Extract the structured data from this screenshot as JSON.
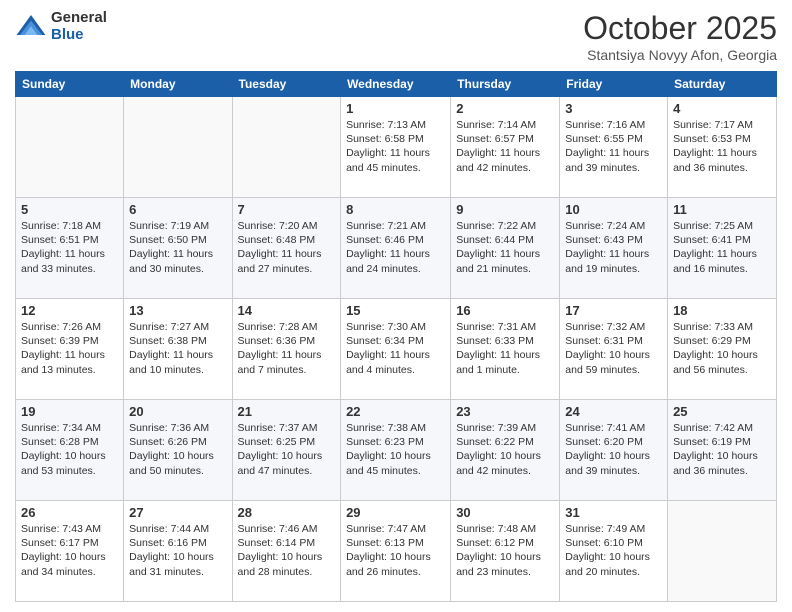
{
  "logo": {
    "general": "General",
    "blue": "Blue"
  },
  "header": {
    "month": "October 2025",
    "location": "Stantsiya Novyy Afon, Georgia"
  },
  "days_of_week": [
    "Sunday",
    "Monday",
    "Tuesday",
    "Wednesday",
    "Thursday",
    "Friday",
    "Saturday"
  ],
  "weeks": [
    [
      {
        "day": "",
        "info": ""
      },
      {
        "day": "",
        "info": ""
      },
      {
        "day": "",
        "info": ""
      },
      {
        "day": "1",
        "info": "Sunrise: 7:13 AM\nSunset: 6:58 PM\nDaylight: 11 hours and 45 minutes."
      },
      {
        "day": "2",
        "info": "Sunrise: 7:14 AM\nSunset: 6:57 PM\nDaylight: 11 hours and 42 minutes."
      },
      {
        "day": "3",
        "info": "Sunrise: 7:16 AM\nSunset: 6:55 PM\nDaylight: 11 hours and 39 minutes."
      },
      {
        "day": "4",
        "info": "Sunrise: 7:17 AM\nSunset: 6:53 PM\nDaylight: 11 hours and 36 minutes."
      }
    ],
    [
      {
        "day": "5",
        "info": "Sunrise: 7:18 AM\nSunset: 6:51 PM\nDaylight: 11 hours and 33 minutes."
      },
      {
        "day": "6",
        "info": "Sunrise: 7:19 AM\nSunset: 6:50 PM\nDaylight: 11 hours and 30 minutes."
      },
      {
        "day": "7",
        "info": "Sunrise: 7:20 AM\nSunset: 6:48 PM\nDaylight: 11 hours and 27 minutes."
      },
      {
        "day": "8",
        "info": "Sunrise: 7:21 AM\nSunset: 6:46 PM\nDaylight: 11 hours and 24 minutes."
      },
      {
        "day": "9",
        "info": "Sunrise: 7:22 AM\nSunset: 6:44 PM\nDaylight: 11 hours and 21 minutes."
      },
      {
        "day": "10",
        "info": "Sunrise: 7:24 AM\nSunset: 6:43 PM\nDaylight: 11 hours and 19 minutes."
      },
      {
        "day": "11",
        "info": "Sunrise: 7:25 AM\nSunset: 6:41 PM\nDaylight: 11 hours and 16 minutes."
      }
    ],
    [
      {
        "day": "12",
        "info": "Sunrise: 7:26 AM\nSunset: 6:39 PM\nDaylight: 11 hours and 13 minutes."
      },
      {
        "day": "13",
        "info": "Sunrise: 7:27 AM\nSunset: 6:38 PM\nDaylight: 11 hours and 10 minutes."
      },
      {
        "day": "14",
        "info": "Sunrise: 7:28 AM\nSunset: 6:36 PM\nDaylight: 11 hours and 7 minutes."
      },
      {
        "day": "15",
        "info": "Sunrise: 7:30 AM\nSunset: 6:34 PM\nDaylight: 11 hours and 4 minutes."
      },
      {
        "day": "16",
        "info": "Sunrise: 7:31 AM\nSunset: 6:33 PM\nDaylight: 11 hours and 1 minute."
      },
      {
        "day": "17",
        "info": "Sunrise: 7:32 AM\nSunset: 6:31 PM\nDaylight: 10 hours and 59 minutes."
      },
      {
        "day": "18",
        "info": "Sunrise: 7:33 AM\nSunset: 6:29 PM\nDaylight: 10 hours and 56 minutes."
      }
    ],
    [
      {
        "day": "19",
        "info": "Sunrise: 7:34 AM\nSunset: 6:28 PM\nDaylight: 10 hours and 53 minutes."
      },
      {
        "day": "20",
        "info": "Sunrise: 7:36 AM\nSunset: 6:26 PM\nDaylight: 10 hours and 50 minutes."
      },
      {
        "day": "21",
        "info": "Sunrise: 7:37 AM\nSunset: 6:25 PM\nDaylight: 10 hours and 47 minutes."
      },
      {
        "day": "22",
        "info": "Sunrise: 7:38 AM\nSunset: 6:23 PM\nDaylight: 10 hours and 45 minutes."
      },
      {
        "day": "23",
        "info": "Sunrise: 7:39 AM\nSunset: 6:22 PM\nDaylight: 10 hours and 42 minutes."
      },
      {
        "day": "24",
        "info": "Sunrise: 7:41 AM\nSunset: 6:20 PM\nDaylight: 10 hours and 39 minutes."
      },
      {
        "day": "25",
        "info": "Sunrise: 7:42 AM\nSunset: 6:19 PM\nDaylight: 10 hours and 36 minutes."
      }
    ],
    [
      {
        "day": "26",
        "info": "Sunrise: 7:43 AM\nSunset: 6:17 PM\nDaylight: 10 hours and 34 minutes."
      },
      {
        "day": "27",
        "info": "Sunrise: 7:44 AM\nSunset: 6:16 PM\nDaylight: 10 hours and 31 minutes."
      },
      {
        "day": "28",
        "info": "Sunrise: 7:46 AM\nSunset: 6:14 PM\nDaylight: 10 hours and 28 minutes."
      },
      {
        "day": "29",
        "info": "Sunrise: 7:47 AM\nSunset: 6:13 PM\nDaylight: 10 hours and 26 minutes."
      },
      {
        "day": "30",
        "info": "Sunrise: 7:48 AM\nSunset: 6:12 PM\nDaylight: 10 hours and 23 minutes."
      },
      {
        "day": "31",
        "info": "Sunrise: 7:49 AM\nSunset: 6:10 PM\nDaylight: 10 hours and 20 minutes."
      },
      {
        "day": "",
        "info": ""
      }
    ]
  ]
}
